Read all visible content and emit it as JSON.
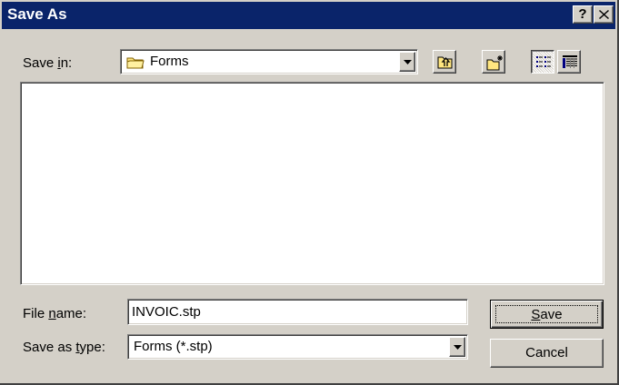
{
  "window": {
    "title": "Save As",
    "help_label": "?"
  },
  "save_in": {
    "label_pre": "Save ",
    "label_accel": "i",
    "label_post": "n:",
    "value": "Forms"
  },
  "file_name": {
    "label_pre": "File ",
    "label_accel": "n",
    "label_post": "ame:",
    "value": "INVOIC.stp"
  },
  "save_as_type": {
    "label_pre": "Save as ",
    "label_accel": "t",
    "label_post": "ype:",
    "value": "Forms (*.stp)"
  },
  "buttons": {
    "save_accel": "S",
    "save_rest": "ave",
    "cancel": "Cancel"
  },
  "toolbar": {
    "icons": [
      "up-one-level-icon",
      "create-new-folder-icon",
      "list-view-icon",
      "details-view-icon"
    ]
  },
  "colors": {
    "titlebar": "#0a246a",
    "face": "#d4d0c8"
  }
}
